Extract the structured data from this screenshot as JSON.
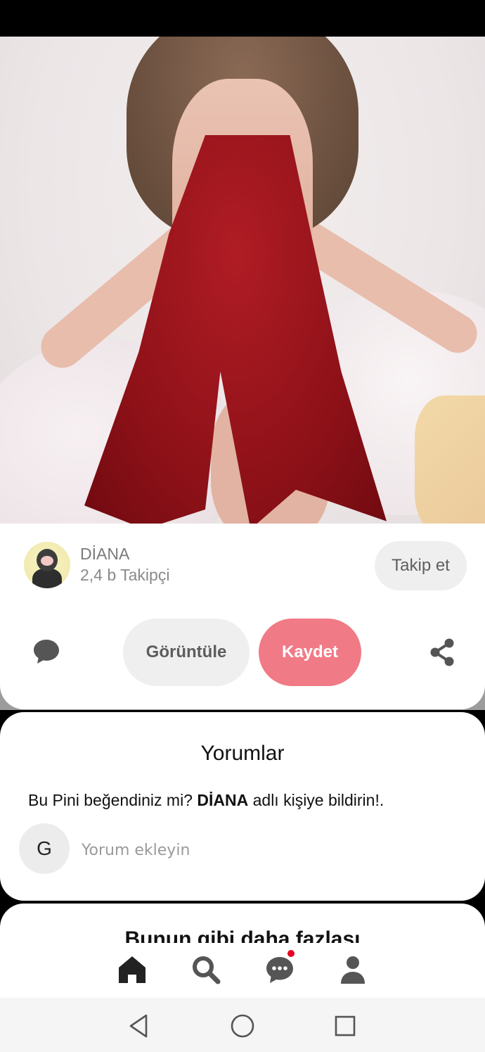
{
  "pin": {
    "image_alt": "pin-photo"
  },
  "creator": {
    "name": "DİANA",
    "followers": "2,4 b Takipçi",
    "follow_label": "Takip et"
  },
  "actions": {
    "view_label": "Görüntüle",
    "save_label": "Kaydet",
    "save_color": "#f07a86"
  },
  "comments": {
    "title": "Yorumlar",
    "prompt_before": "Bu Pini beğendiniz mi? ",
    "prompt_name": "DİANA",
    "prompt_after": " adlı kişiye bildirin!.",
    "user_initial": "G",
    "input_placeholder": "Yorum ekleyin",
    "input_value": ""
  },
  "more": {
    "title": "Bunun gibi daha fazlası"
  },
  "tabs": [
    {
      "name": "home",
      "icon": "home-icon",
      "active": true
    },
    {
      "name": "search",
      "icon": "search-icon",
      "active": false
    },
    {
      "name": "messages",
      "icon": "chat-bubble-icon",
      "active": false,
      "has_notification": true
    },
    {
      "name": "profile",
      "icon": "person-icon",
      "active": false
    }
  ],
  "system_nav": [
    "back-icon",
    "home-circle-icon",
    "recents-square-icon"
  ],
  "colors": {
    "notification_dot": "#e60023",
    "icon_dark": "#222222",
    "icon_gray": "#555555"
  }
}
